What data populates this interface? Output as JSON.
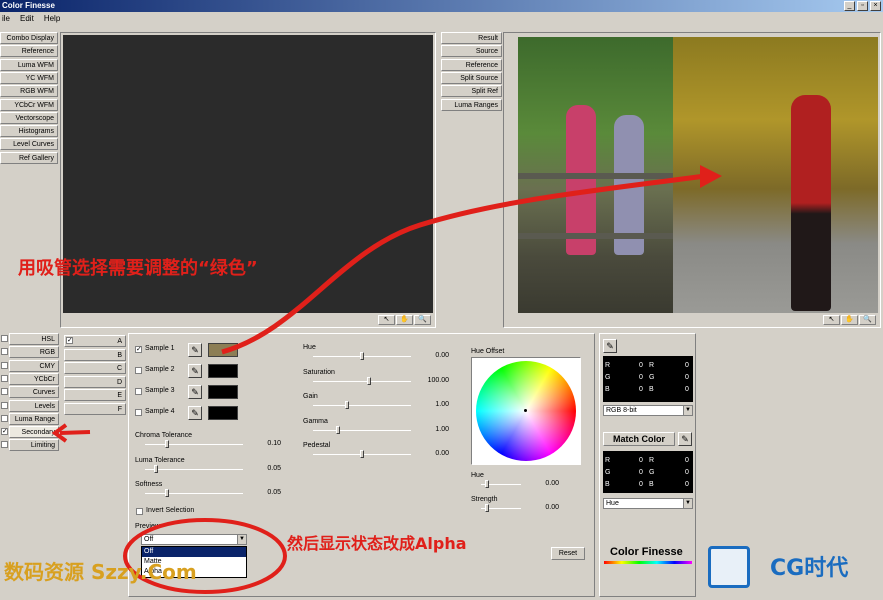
{
  "window": {
    "title": "Color Finesse"
  },
  "menu": [
    "ile",
    "Edit",
    "Help"
  ],
  "left_view_buttons": [
    "Combo Display",
    "Reference",
    "Luma WFM",
    "YC WFM",
    "RGB WFM",
    "YCbCr WFM",
    "Vectorscope",
    "Histograms",
    "Level Curves",
    "Ref Gallery"
  ],
  "right_view_buttons": [
    "Result",
    "Source",
    "Reference",
    "Split Source",
    "Split Ref",
    "Luma Ranges"
  ],
  "bottom_tabs": [
    {
      "label": "HSL",
      "checked": false
    },
    {
      "label": "RGB",
      "checked": false
    },
    {
      "label": "CMY",
      "checked": false
    },
    {
      "label": "YCbCr",
      "checked": false
    },
    {
      "label": "Curves",
      "checked": false
    },
    {
      "label": "Levels",
      "checked": false
    },
    {
      "label": "Luma Range",
      "checked": false
    },
    {
      "label": "Secondary",
      "checked": true
    },
    {
      "label": "Limiting",
      "checked": false
    }
  ],
  "channel_tabs": [
    "A",
    "B",
    "C",
    "D",
    "E",
    "F"
  ],
  "samples": [
    {
      "label": "Sample 1",
      "checked": true,
      "color": "#8c7e55"
    },
    {
      "label": "Sample 2",
      "checked": false,
      "color": "#000000"
    },
    {
      "label": "Sample 3",
      "checked": false,
      "color": "#000000"
    },
    {
      "label": "Sample 4",
      "checked": false,
      "color": "#000000"
    }
  ],
  "tolerances": [
    {
      "label": "Chroma Tolerance",
      "value": "0.10",
      "pos": 0.22
    },
    {
      "label": "Luma Tolerance",
      "value": "0.05",
      "pos": 0.11
    },
    {
      "label": "Softness",
      "value": "0.05",
      "pos": 0.22
    }
  ],
  "invert_selection": "Invert Selection",
  "preview": {
    "label": "Preview",
    "value": "Off",
    "options": [
      "Off",
      "Matte",
      "Alpha"
    ]
  },
  "adjust": [
    {
      "label": "Hue",
      "value": "0.00",
      "pos": 0.5
    },
    {
      "label": "Saturation",
      "value": "100.00",
      "pos": 0.57
    },
    {
      "label": "Gain",
      "value": "1.00",
      "pos": 0.35
    },
    {
      "label": "Gamma",
      "value": "1.00",
      "pos": 0.25
    },
    {
      "label": "Pedestal",
      "value": "0.00",
      "pos": 0.5
    }
  ],
  "hue_offset": {
    "label": "Hue Offset"
  },
  "hue_controls": [
    {
      "label": "Hue",
      "value": "0.00",
      "pos": 0.15
    },
    {
      "label": "Strength",
      "value": "0.00",
      "pos": 0.15
    }
  ],
  "reset_label": "Reset",
  "readout1": {
    "rows": [
      [
        "R",
        "0",
        "R",
        "0"
      ],
      [
        "G",
        "0",
        "G",
        "0"
      ],
      [
        "B",
        "0",
        "B",
        "0"
      ]
    ]
  },
  "readout2": {
    "rows": [
      [
        "R",
        "0",
        "R",
        "0"
      ],
      [
        "G",
        "0",
        "G",
        "0"
      ],
      [
        "B",
        "0",
        "B",
        "0"
      ]
    ]
  },
  "format_select": "RGB 8-bit",
  "match_color": "Match Color",
  "match_select": "Hue",
  "brand": "Color Finesse",
  "annotations": {
    "eyedropper": "用吸管选择需要调整的“绿色”",
    "alpha": "然后显示状态改成Alpha",
    "watermark_left": "数码资源 Szzy.Com",
    "watermark_right": "CG时代"
  }
}
